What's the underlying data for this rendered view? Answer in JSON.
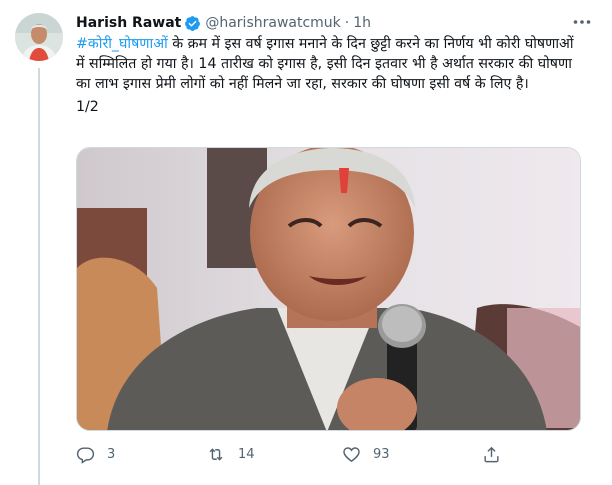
{
  "author": {
    "name": "Harish Rawat",
    "handle": "@harishrawatcmuk",
    "separator": "·",
    "time": "1h"
  },
  "tweet": {
    "hashtag": "#कोरी_घोषणाओं",
    "line1_rest": " के क्रम में इस वर्ष इगास मनाने के दिन छुट्टी करने का निर्णय भी कोरी घोषणाओं में सम्मिलित हो गया है। 14 तारीख को इगास है, इसी दिन इतवार भी है अर्थात सरकार की घोषणा का लाभ इगास प्रेमी लोगों को नहीं मिलने जा रहा, सरकार की घोषणा इसी वर्ष के लिए है।",
    "page_marker": "1/2"
  },
  "actions": {
    "replies": "3",
    "retweets": "14",
    "likes": "93"
  },
  "icons": {
    "verified": "verified-badge-icon",
    "more": "more-icon",
    "reply": "reply-icon",
    "retweet": "retweet-icon",
    "like": "heart-icon",
    "share": "share-icon"
  },
  "colors": {
    "accent": "#1d9bf0",
    "secondary_text": "#536471",
    "text": "#0f1419"
  }
}
